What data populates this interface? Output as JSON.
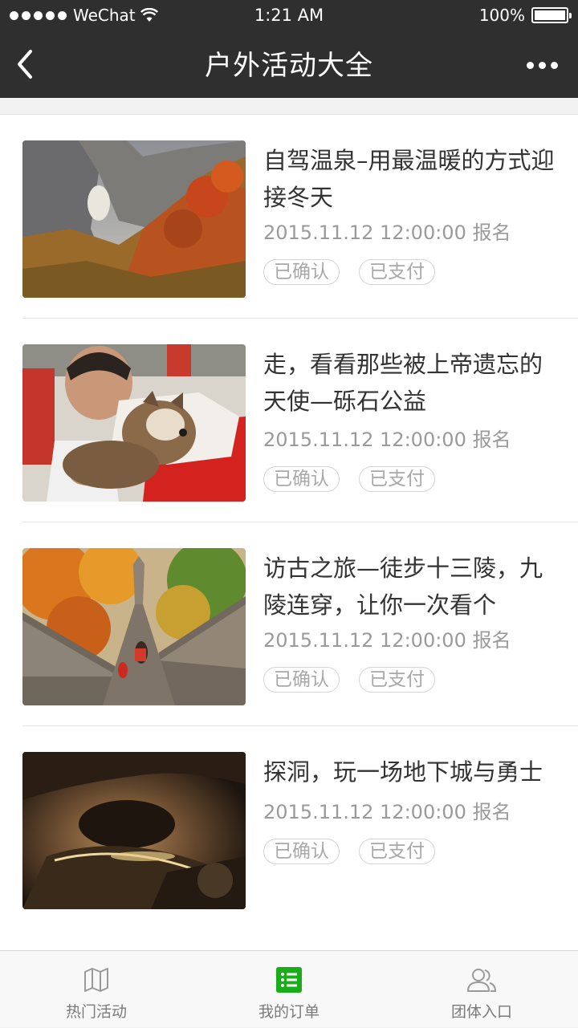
{
  "status_bar": {
    "carrier": "WeChat",
    "time": "1:21 AM",
    "battery": "100%"
  },
  "nav": {
    "title": "户外活动大全"
  },
  "items": [
    {
      "title": "自驾温泉–用最温暖的方式迎接冬天",
      "time": "2015.11.12 12:00:00 报名",
      "tags": [
        "已确认",
        "已支付"
      ]
    },
    {
      "title": "走，看看那些被上帝遗忘的天使—砾石公益",
      "time": "2015.11.12 12:00:00 报名",
      "tags": [
        "已确认",
        "已支付"
      ]
    },
    {
      "title": "访古之旅—徒步十三陵，九陵连穿，让你一次看个",
      "time": "2015.11.12 12:00:00 报名",
      "tags": [
        "已确认",
        "已支付"
      ]
    },
    {
      "title": "探洞，玩一场地下城与勇士",
      "time": "2015.11.12 12:00:00 报名",
      "tags": [
        "已确认",
        "已支付"
      ]
    }
  ],
  "tabs": [
    {
      "label": "热门活动",
      "icon": "map-icon"
    },
    {
      "label": "我的订单",
      "icon": "list-icon",
      "active": true
    },
    {
      "label": "团体入口",
      "icon": "users-icon"
    }
  ],
  "colors": {
    "nav_bg": "#2f2f2f",
    "accent_green": "#1aad19"
  }
}
